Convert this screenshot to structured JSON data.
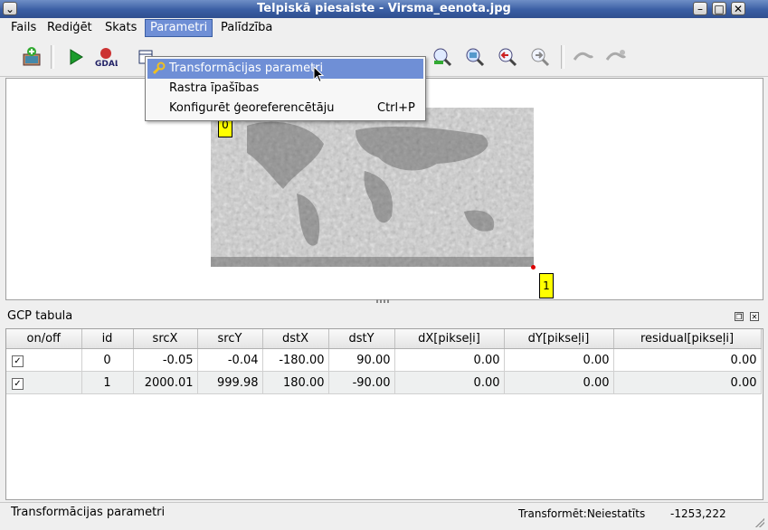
{
  "window": {
    "title": "Telpiskā piesaiste - Virsma_eenota.jpg",
    "controls": [
      "system-menu",
      "minimize",
      "maximize",
      "close"
    ]
  },
  "menubar": {
    "items": [
      "Fails",
      "Rediģēt",
      "Skats",
      "Parametri",
      "Palīdzība"
    ],
    "active": "Parametri"
  },
  "dropdown": {
    "items": [
      {
        "label": "Transformācijas parametri",
        "shortcut": "",
        "icon": "wrench-icon",
        "highlighted": true
      },
      {
        "label": "Rastra īpašības",
        "shortcut": "",
        "icon": "",
        "highlighted": false
      },
      {
        "label": "Konfigurēt ģeoreferencētāju",
        "shortcut": "Ctrl+P",
        "icon": "",
        "highlighted": false
      }
    ]
  },
  "toolbar": {
    "buttons": [
      "open-raster-icon",
      "start-georeferencing-icon",
      "gdal-script-icon",
      "load-gcp-icon",
      "zoom-in-icon",
      "zoom-layer-icon",
      "zoom-last-icon",
      "zoom-next-icon",
      "link-georeferencer-icon",
      "link-qgis-icon"
    ]
  },
  "canvas": {
    "gcp_points": [
      {
        "label": "0"
      },
      {
        "label": "1"
      }
    ]
  },
  "gcp_panel": {
    "title": "GCP tabula",
    "columns": [
      "on/off",
      "id",
      "srcX",
      "srcY",
      "dstX",
      "dstY",
      "dX[pikseļi]",
      "dY[pikseļi]",
      "residual[pikseļi]"
    ],
    "rows": [
      {
        "on": true,
        "id": "0",
        "srcX": "-0.05",
        "srcY": "-0.04",
        "dstX": "-180.00",
        "dstY": "90.00",
        "dX": "0.00",
        "dY": "0.00",
        "residual": "0.00"
      },
      {
        "on": true,
        "id": "1",
        "srcX": "2000.01",
        "srcY": "999.98",
        "dstX": "180.00",
        "dstY": "-90.00",
        "dX": "0.00",
        "dY": "0.00",
        "residual": "0.00"
      }
    ]
  },
  "statusbar": {
    "message": "Transformācijas parametri",
    "transform": "Transformēt:Neiestatīts",
    "coords": "-1253,222"
  },
  "colors": {
    "title_bar": "#3a5ea3",
    "menu_highlight": "#6f8fd6",
    "gcp_label": "#ffff00",
    "gcp_point": "#dd0000"
  }
}
